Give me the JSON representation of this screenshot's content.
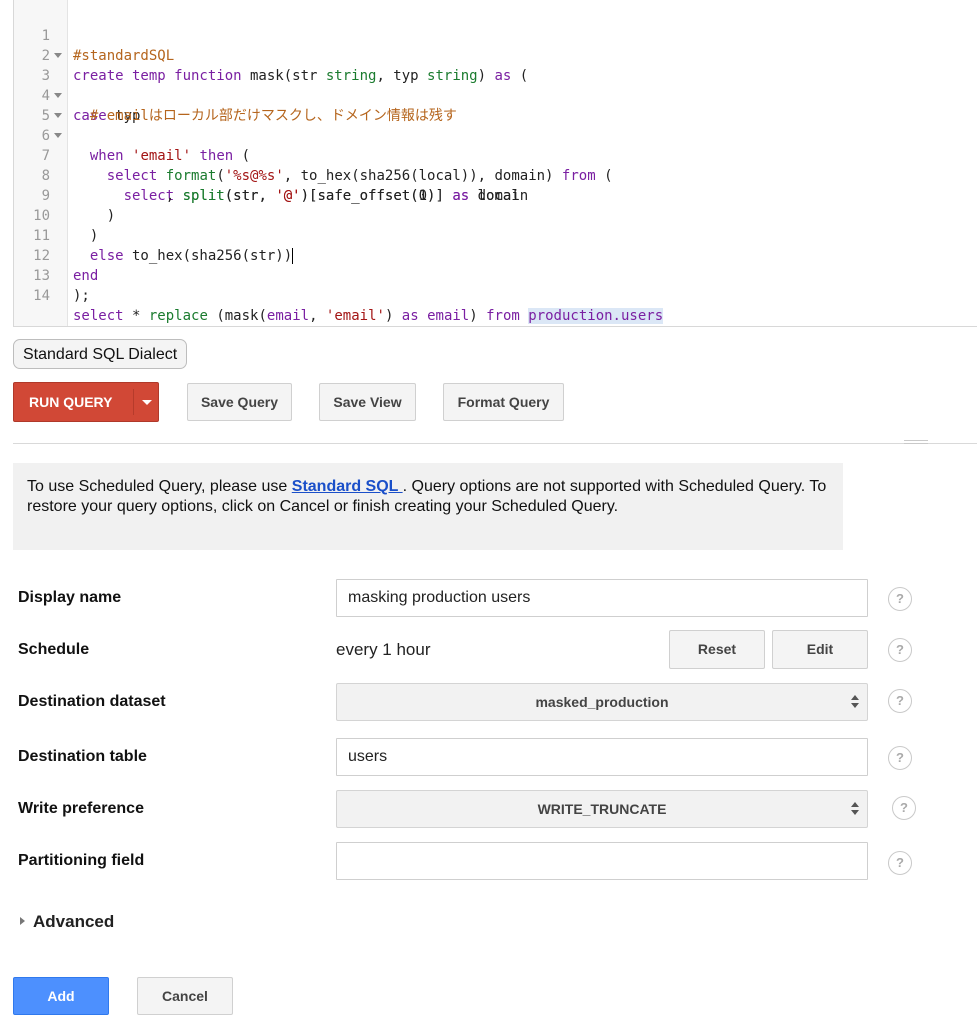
{
  "editor": {
    "line_numbers": [
      "1",
      "2",
      "3",
      "4",
      "5",
      "6",
      "7",
      "8",
      "9",
      "10",
      "11",
      "12",
      "13",
      "14"
    ],
    "lines": {
      "l1": {
        "a": "#standardSQL"
      },
      "l2": {
        "a": "create temp function",
        "b": " mask(str ",
        "c": "string",
        "d": ", typ ",
        "e": "string",
        "f": ") ",
        "g": "as",
        "h": " ("
      },
      "l3": {
        "a": "case",
        "b": " typ"
      },
      "l4": {
        "a": "  # emailはローカル部だけマスクし、ドメイン情報は残す"
      },
      "l5": {
        "a": "  when",
        "b": " ",
        "c": "'email'",
        "d": " ",
        "e": "then",
        "f": " ("
      },
      "l6": {
        "a": "    select",
        "b": " ",
        "c": "format",
        "d": "(",
        "e": "'%s@%s'",
        "f": ", to_hex(sha256(local)), domain) ",
        "g": "from",
        "h": " ("
      },
      "l7": {
        "a": "      select",
        "b": " ",
        "c": "split",
        "d": "(str, ",
        "e": "'@'",
        "f": ")[safe_offset(0)] ",
        "g": "as",
        "h": " local"
      },
      "l8": {
        "a": "           , ",
        "b": "split",
        "c": "(str, ",
        "d": "'@'",
        "e": ")[safe_offset(1)] ",
        "f": "as",
        "g": " domain"
      },
      "l9": {
        "a": "    )"
      },
      "l10": {
        "a": "  )"
      },
      "l11": {
        "a": "  else",
        "b": " to_hex(sha256(str))"
      },
      "l12": {
        "a": "end"
      },
      "l13": {
        "a": ");"
      },
      "l14": {
        "a": "select",
        "b": " * ",
        "c": "replace",
        "d": " (mask(",
        "e": "email",
        "f": ", ",
        "g": "'email'",
        "h": ") ",
        "i": "as",
        "j": " ",
        "k": "email",
        "l": ") ",
        "m": "from",
        "n": " ",
        "o": "production.users"
      }
    }
  },
  "dialect_button": "Standard SQL Dialect",
  "toolbar": {
    "run_query": "RUN QUERY",
    "save_query": "Save Query",
    "save_view": "Save View",
    "format_query": "Format Query"
  },
  "notice": {
    "text_before": "To use Scheduled Query, please use ",
    "link": "Standard SQL ",
    "text_after": ". Query options are not supported with Scheduled Query. To restore your query options, click on Cancel or finish creating your Scheduled Query."
  },
  "form": {
    "display_name": {
      "label": "Display name",
      "value": "masking production users"
    },
    "schedule": {
      "label": "Schedule",
      "value": "every 1 hour",
      "reset": "Reset",
      "edit": "Edit"
    },
    "destination_dataset": {
      "label": "Destination dataset",
      "value": "masked_production"
    },
    "destination_table": {
      "label": "Destination table",
      "value": "users"
    },
    "write_preference": {
      "label": "Write preference",
      "value": "WRITE_TRUNCATE"
    },
    "partitioning_field": {
      "label": "Partitioning field",
      "value": ""
    },
    "help_glyph": "?"
  },
  "advanced": "Advanced",
  "actions": {
    "add": "Add",
    "cancel": "Cancel"
  },
  "colors": {
    "run_button": "#d14836",
    "add_button": "#4d90fe",
    "link": "#1a4fc9"
  }
}
